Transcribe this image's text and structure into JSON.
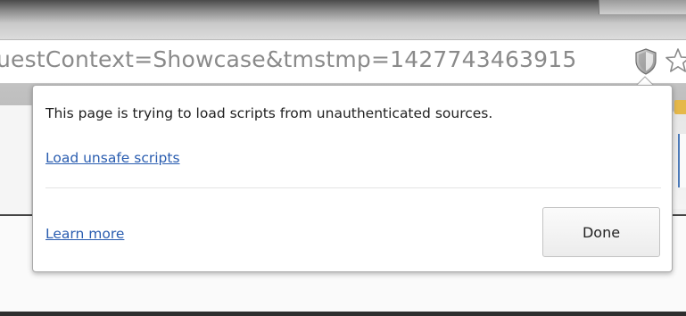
{
  "omnibox": {
    "url": "uestContext=Showcase&tmstmp=1427743463915",
    "shield_icon": "shield-icon",
    "star_icon": "star-icon"
  },
  "bubble": {
    "message": "This page is trying to load scripts from unauthenticated sources.",
    "load_link": "Load unsafe scripts",
    "learn_more": "Learn more",
    "done_label": "Done"
  },
  "colors": {
    "link": "#2a5db0",
    "text": "#222222",
    "url_text": "#8a8a8a",
    "bookmark_accent": "#e5b84a"
  }
}
